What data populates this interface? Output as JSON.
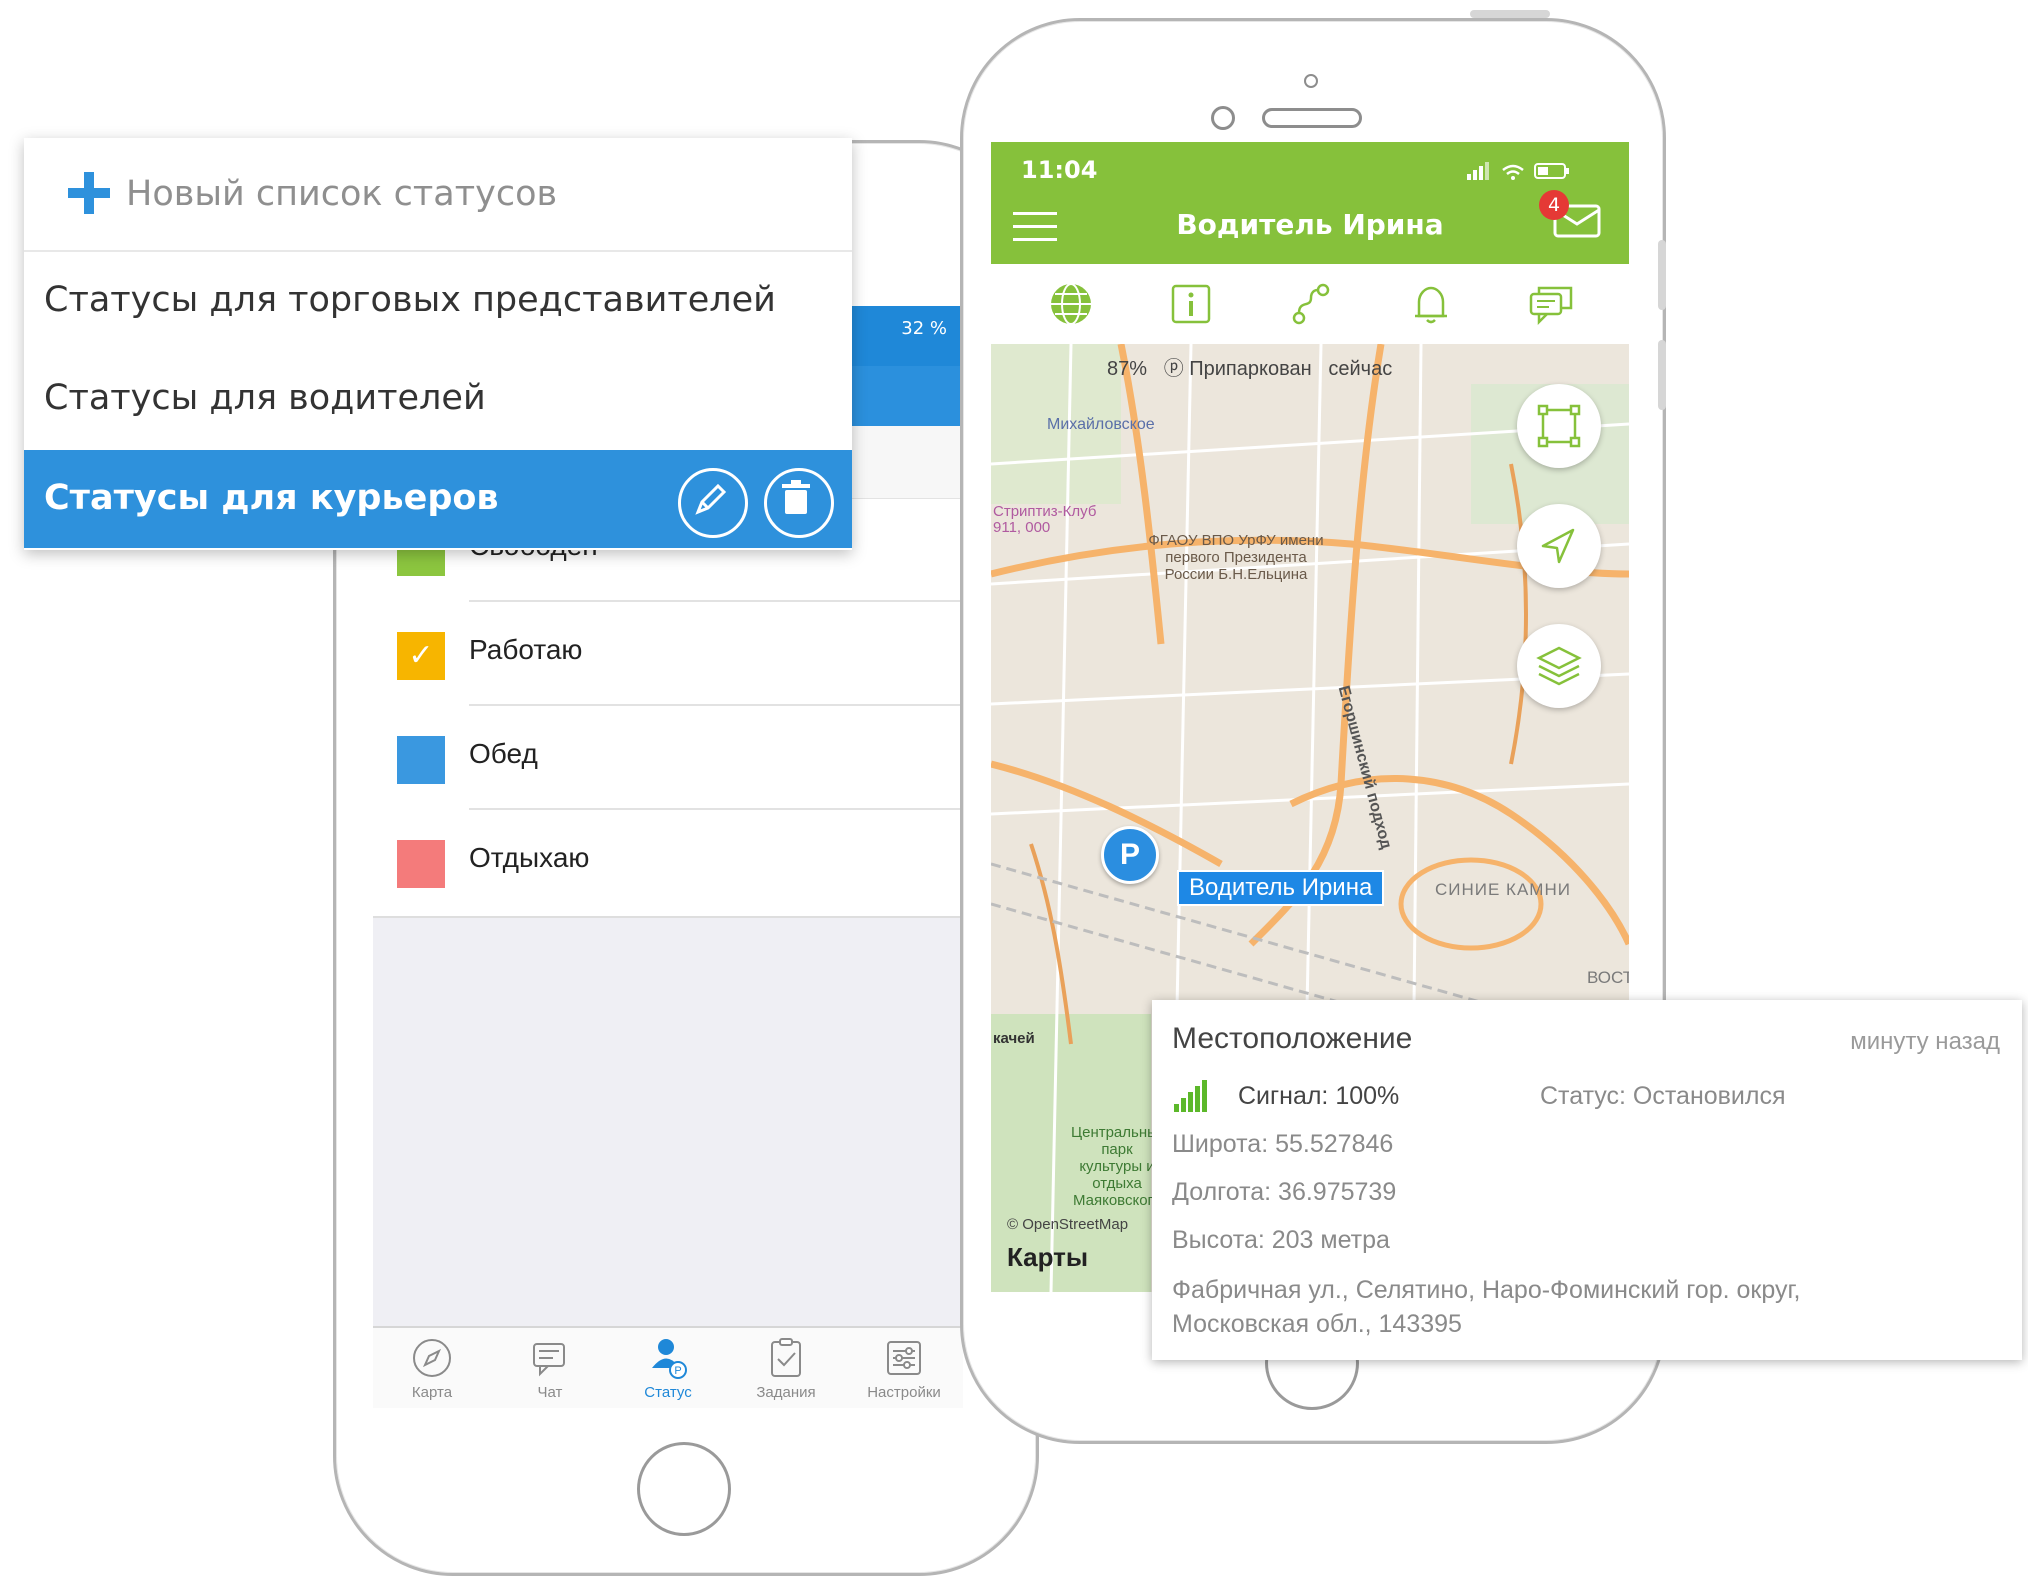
{
  "dropdown": {
    "new_list_label": "Новый список статусов",
    "items": [
      {
        "label": "Статусы для торговых представителей"
      },
      {
        "label": "Статусы для водителей"
      },
      {
        "label": "Статусы для курьеров",
        "selected": true
      }
    ]
  },
  "left_phone": {
    "battery_text": "32 %",
    "statuses": [
      {
        "label": "Свободен",
        "color": "#8cc63f"
      },
      {
        "label": "Работаю",
        "color": "#f7b500",
        "checked": true
      },
      {
        "label": "Обед",
        "color": "#3a98e0"
      },
      {
        "label": "Отдыхаю",
        "color": "#f47b7b"
      }
    ],
    "tabs": [
      {
        "label": "Карта",
        "icon": "compass-icon"
      },
      {
        "label": "Чат",
        "icon": "chat-icon"
      },
      {
        "label": "Статус",
        "icon": "user-status-icon",
        "active": true
      },
      {
        "label": "Задания",
        "icon": "clipboard-icon"
      },
      {
        "label": "Настройки",
        "icon": "sliders-icon"
      }
    ]
  },
  "right_phone": {
    "time": "11:04",
    "title": "Водитель Ирина",
    "badge_count": "4",
    "accent_color": "#86c13b",
    "tab_icons": [
      "globe-icon",
      "info-icon",
      "route-icon",
      "bell-icon",
      "messages-icon"
    ],
    "map": {
      "battery": "87%",
      "parked": "Припаркован",
      "time": "сейчас",
      "marker_letter": "P",
      "driver_label": "Водитель Ирина",
      "maps_brand": "Карты",
      "osm_credit": "© OpenStreetMap",
      "labels": {
        "mikhailovskoe": "Михайловское",
        "striptease": "Стриптиз-Клуб 911, 000",
        "university": "ФГАОУ ВПО УрФУ имени первого Президента России Б.Н.Ельцина",
        "eroshinsky": "Егоршинский подход",
        "sinie_kamni": "СИНИЕ КАМНИ",
        "central_park": "Центральный парк культуры и отдыха Маяковского",
        "vostok": "ВОСТ",
        "kachey": "качей"
      }
    }
  },
  "location_card": {
    "title": "Местоположение",
    "time_ago": "минуту назад",
    "signal": "Сигнал: 100%",
    "status": "Статус: Остановился",
    "latitude": "Широта: 55.527846",
    "longitude": "Долгота: 36.975739",
    "altitude": "Высота: 203 метра",
    "address_line1": "Фабричная ул., Селятино, Наро-Фоминский гор. округ,",
    "address_line2": "Московская обл., 143395"
  }
}
